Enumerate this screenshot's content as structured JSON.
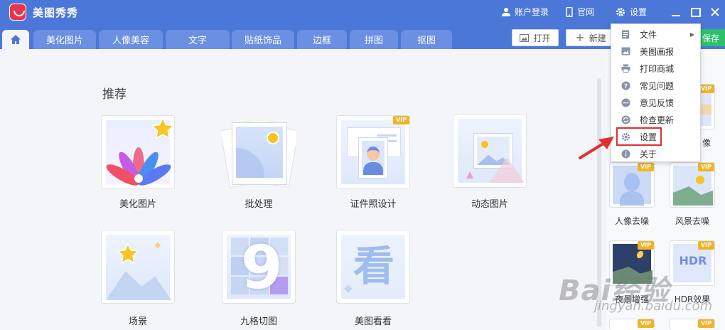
{
  "app": {
    "title": "美图秀秀"
  },
  "titlebar": {
    "account": "账户登录",
    "website": "官网",
    "settings": "设置"
  },
  "tabs": [
    "美化图片",
    "人像美容",
    "文字",
    "贴纸饰品",
    "边框",
    "拼图",
    "抠图"
  ],
  "toolbar": {
    "open": "打开",
    "new": "新建",
    "save": "保存"
  },
  "section": {
    "title": "推荐"
  },
  "cards": [
    {
      "label": "美化图片"
    },
    {
      "label": "批处理"
    },
    {
      "label": "证件照设计",
      "badge": "VIP"
    },
    {
      "label": "动态图片"
    },
    {
      "label": "场景"
    },
    {
      "label": "九格切图"
    },
    {
      "label": "美图看看"
    }
  ],
  "right_panel": {
    "items": [
      {
        "label": "像",
        "badge": "VIP"
      },
      {
        "label": "人像去噪",
        "badge": "VIP"
      },
      {
        "label": "风景去噪",
        "badge": "VIP"
      },
      {
        "label": "夜景增强",
        "badge": "VIP"
      },
      {
        "label": "HDR效果",
        "badge": "VIP",
        "thumb_text": "HDR"
      }
    ],
    "vip_badge": "VIP"
  },
  "menu": {
    "items": [
      {
        "label": "文件",
        "icon": "file-icon"
      },
      {
        "label": "美图画报",
        "icon": "picture-icon"
      },
      {
        "label": "打印商城",
        "icon": "printer-icon"
      },
      {
        "label": "常见问题",
        "icon": "question-icon"
      },
      {
        "label": "意见反馈",
        "icon": "feedback-icon"
      },
      {
        "label": "检查更新",
        "icon": "refresh-icon"
      },
      {
        "label": "设置",
        "icon": "gear-icon"
      },
      {
        "label": "关于",
        "icon": "info-icon"
      }
    ]
  },
  "watermark": {
    "text": "Bai经验",
    "url": "jingyan.baidu.com"
  },
  "colors": {
    "primary": "#4b77d9",
    "tab": "#6b8fe3",
    "vip": "#f2b324",
    "save": "#2cc06a",
    "highlight": "#e0302f"
  }
}
